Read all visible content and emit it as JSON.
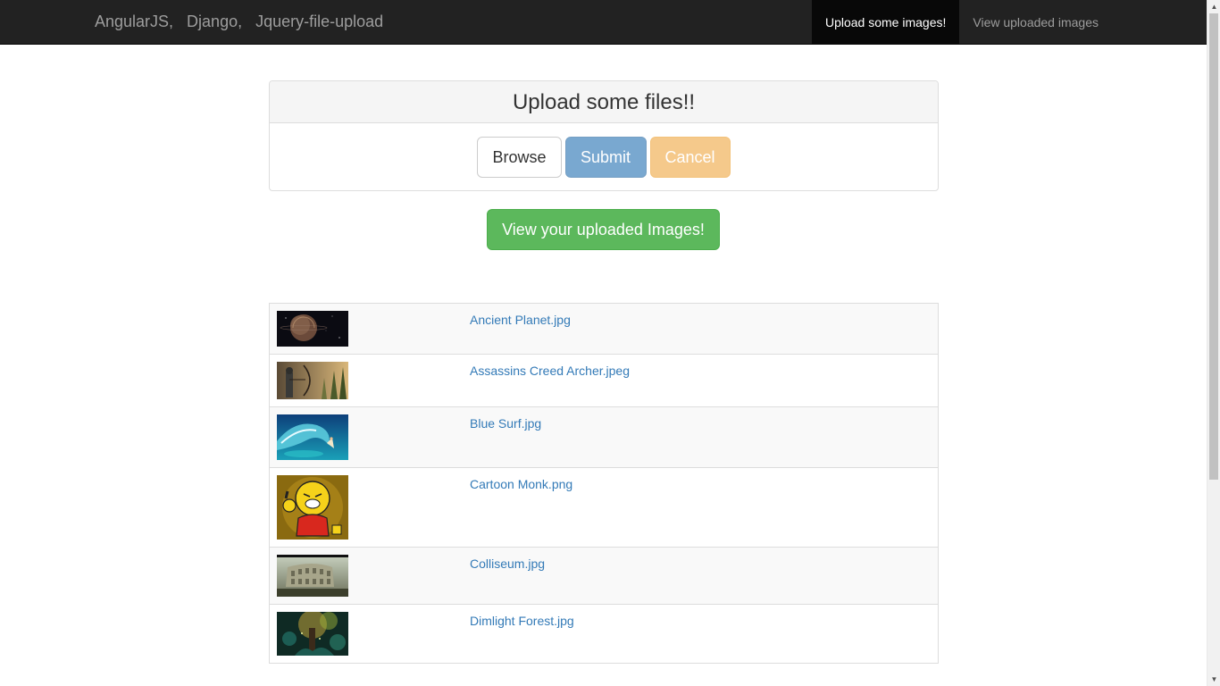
{
  "navbar": {
    "brand": "AngularJS,   Django,   Jquery-file-upload",
    "links": [
      {
        "label": "Upload some images!",
        "active": true
      },
      {
        "label": "View uploaded images",
        "active": false
      }
    ]
  },
  "upload_panel": {
    "title": "Upload some files!!",
    "browse_label": "Browse",
    "submit_label": "Submit",
    "cancel_label": "Cancel"
  },
  "view_button_label": "View your uploaded Images!",
  "files": [
    {
      "name": "Ancient Planet.jpg",
      "thumb_icon": "planet-thumbnail"
    },
    {
      "name": "Assassins Creed Archer.jpeg",
      "thumb_icon": "archer-thumbnail"
    },
    {
      "name": "Blue Surf.jpg",
      "thumb_icon": "surf-thumbnail"
    },
    {
      "name": "Cartoon Monk.png",
      "thumb_icon": "monk-thumbnail"
    },
    {
      "name": "Colliseum.jpg",
      "thumb_icon": "colosseum-thumbnail"
    },
    {
      "name": "Dimlight Forest.jpg",
      "thumb_icon": "forest-thumbnail"
    }
  ],
  "colors": {
    "navbar_bg": "#222222",
    "primary": "#337ab7",
    "success": "#5cb85c",
    "warning": "#f0ad4e"
  }
}
